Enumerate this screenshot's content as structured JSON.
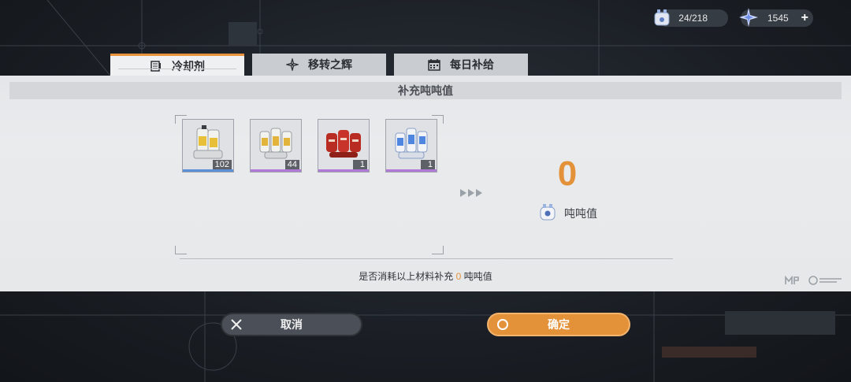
{
  "currency": {
    "stamina": "24/218",
    "gems": "1545",
    "plus_label": "+"
  },
  "tabs": [
    {
      "label": "冷却剂",
      "icon": "list-icon",
      "active": true
    },
    {
      "label": "移转之辉",
      "icon": "star-compass-icon",
      "active": false
    },
    {
      "label": "每日补给",
      "icon": "calendar-icon",
      "active": false
    }
  ],
  "panel": {
    "title": "补充吨吨值",
    "items": [
      {
        "count": "102",
        "rarity_color": "#5b8fd6",
        "art": "yellow-coolant"
      },
      {
        "count": "44",
        "rarity_color": "#b27ad8",
        "art": "gold-coolant-pack"
      },
      {
        "count": "1",
        "rarity_color": "#b27ad8",
        "art": "red-coolant-pack"
      },
      {
        "count": "1",
        "rarity_color": "#b27ad8",
        "art": "blue-coolant-pack"
      }
    ],
    "result": {
      "value": "0",
      "label": "吨吨值"
    },
    "confirm_prefix": "是否消耗以上材料补充",
    "confirm_value": "0",
    "confirm_suffix": "吨吨值"
  },
  "buttons": {
    "cancel": "取消",
    "ok": "确定"
  },
  "colors": {
    "accent": "#e3923a",
    "panel_bg": "#e6e8ea",
    "dark_button": "#4b5058"
  }
}
